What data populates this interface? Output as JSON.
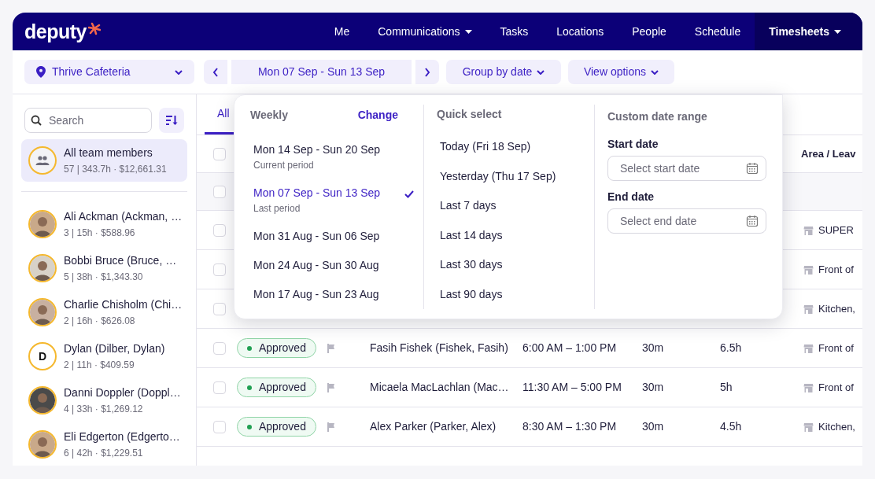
{
  "nav": {
    "logo": "deputy",
    "items": [
      {
        "label": "Me",
        "dropdown": false,
        "selected": false
      },
      {
        "label": "Communications",
        "dropdown": true,
        "selected": false
      },
      {
        "label": "Tasks",
        "dropdown": false,
        "selected": false
      },
      {
        "label": "Locations",
        "dropdown": false,
        "selected": false
      },
      {
        "label": "People",
        "dropdown": false,
        "selected": false
      },
      {
        "label": "Schedule",
        "dropdown": false,
        "selected": false
      },
      {
        "label": "Timesheets",
        "dropdown": true,
        "selected": true
      }
    ]
  },
  "toolbar": {
    "location": "Thrive Cafeteria",
    "date_range": "Mon 07 Sep - Sun 13 Sep",
    "group_by": "Group by date",
    "view_options": "View options"
  },
  "sidebar": {
    "search_placeholder": "Search",
    "all": {
      "name": "All team members",
      "stats": "57 | 343.7h · $12,661.31",
      "selected": true
    },
    "members": [
      {
        "name": "Ali Ackman (Ackman, …",
        "stats": "3 | 15h · $588.96",
        "avatar": {
          "kind": "photo"
        }
      },
      {
        "name": "Bobbi Bruce (Bruce, …",
        "stats": "5 | 38h · $1,343.30",
        "avatar": {
          "kind": "photo"
        }
      },
      {
        "name": "Charlie Chisholm (Chi…",
        "stats": "2 | 16h · $626.08",
        "avatar": {
          "kind": "photo"
        }
      },
      {
        "name": "Dylan (Dilber, Dylan)",
        "stats": "2 | 11h · $409.59",
        "avatar": {
          "kind": "initial",
          "text": "D"
        }
      },
      {
        "name": "Danni Doppler (Doppl…",
        "stats": "4 | 33h · $1,269.12",
        "avatar": {
          "kind": "photo"
        }
      },
      {
        "name": "Eli Edgerton (Edgerto…",
        "stats": "6 | 42h · $1,229.51",
        "avatar": {
          "kind": "photo"
        }
      }
    ]
  },
  "tabs": [
    {
      "label": "All",
      "selected": true
    }
  ],
  "table": {
    "area_header": "Area / Leav",
    "header_checked": false,
    "rows": [
      {
        "kind": "group",
        "checked": false
      },
      {
        "kind": "entry",
        "checked": false,
        "area": "SUPER"
      },
      {
        "kind": "entry",
        "checked": false,
        "area": "Front of"
      },
      {
        "kind": "entry",
        "checked": false,
        "area": "Kitchen,"
      },
      {
        "kind": "entry",
        "checked": false,
        "status": "Approved",
        "employee": "Fasih Fishek (Fishek, Fasih)",
        "time": "6:00 AM – 1:00 PM",
        "break": "30m",
        "hours": "6.5h",
        "area": "Front of"
      },
      {
        "kind": "entry",
        "checked": false,
        "status": "Approved",
        "employee": "Micaela MacLachlan (Mac…",
        "time": "11:30 AM – 5:00 PM",
        "break": "30m",
        "hours": "5h",
        "area": "Front of"
      },
      {
        "kind": "entry",
        "checked": false,
        "status": "Approved",
        "employee": "Alex Parker (Parker, Alex)",
        "time": "8:30 AM – 1:30 PM",
        "break": "30m",
        "hours": "4.5h",
        "area": "Kitchen,"
      }
    ]
  },
  "popover": {
    "weekly": {
      "title": "Weekly",
      "change": "Change",
      "items": [
        {
          "label": "Mon 14 Sep - Sun 20 Sep",
          "note": "Current period",
          "selected": false
        },
        {
          "label": "Mon 07 Sep - Sun 13 Sep",
          "note": "Last period",
          "selected": true
        },
        {
          "label": "Mon 31 Aug - Sun 06 Sep",
          "selected": false
        },
        {
          "label": "Mon 24 Aug - Sun 30 Aug",
          "selected": false
        },
        {
          "label": "Mon 17 Aug - Sun 23 Aug",
          "selected": false
        }
      ]
    },
    "quick": {
      "title": "Quick select",
      "items": [
        "Today (Fri 18 Sep)",
        "Yesterday (Thu 17 Sep)",
        "Last 7 days",
        "Last 14 days",
        "Last 30 days",
        "Last 90 days"
      ]
    },
    "custom": {
      "title": "Custom date range",
      "start_label": "Start date",
      "start_placeholder": "Select start date",
      "end_label": "End date",
      "end_placeholder": "Select end date"
    }
  }
}
